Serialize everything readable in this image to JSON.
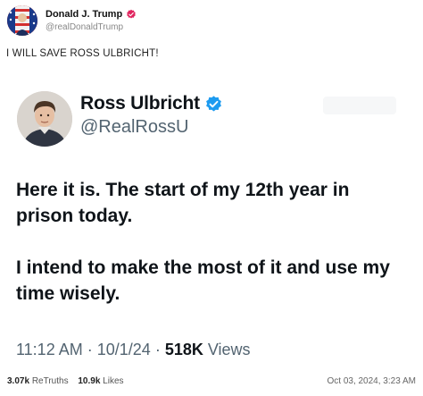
{
  "post": {
    "author_name": "Donald J. Trump",
    "author_handle": "@realDonaldTrump",
    "text": "I WILL SAVE ROSS ULBRICHT!",
    "retruths_count": "3.07k",
    "retruths_label": "ReTruths",
    "likes_count": "10.9k",
    "likes_label": "Likes",
    "timestamp": "Oct 03, 2024, 3:23 AM"
  },
  "embed": {
    "name": "Ross Ulbricht",
    "handle": "@RealRossU",
    "paragraphs": [
      "Here it is. The start of my 12th year in prison today.",
      "I intend to make the most of it and use my time wisely."
    ],
    "time": "11:12 AM",
    "date": "10/1/24",
    "views_count": "518K",
    "views_label": "Views"
  },
  "colors": {
    "verified_badge_small": "#e0245e",
    "verified_badge_large": "#1d9bf0",
    "secondary_text": "#536471"
  }
}
